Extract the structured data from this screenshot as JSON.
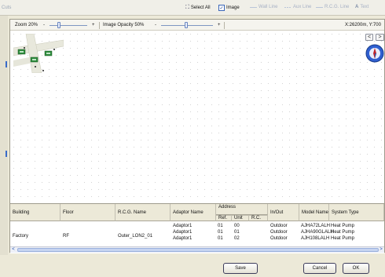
{
  "toolbar": {
    "left_label": "Cuts",
    "select_all": "Select All",
    "image": "Image",
    "wall_line": "Wall Line",
    "aux_line": "Aux Line",
    "rcg_line": "R.C.G. Line",
    "text": "Text"
  },
  "zoom": {
    "zoom_label": "Zoom 20%",
    "opacity_label": "Image Opacity 50%",
    "minus": "-",
    "plus": "+",
    "coords": "X:26200m, Y:700"
  },
  "nav": {
    "left_arrow": "<",
    "right_arrow": ">"
  },
  "table": {
    "headers": {
      "building": "Building",
      "floor": "Floor",
      "rcg_name": "R.C.G. Name",
      "adaptor_name": "Adaptor Name",
      "address": "Address",
      "ref": "Ref.",
      "unit": "Unit",
      "rc": "R.C.",
      "in_out": "In/Out",
      "model_name": "Model Name",
      "system_type": "System Type"
    },
    "group": {
      "building": "Factory",
      "floor": "RF",
      "rcg_name": "Outer_LON2_01"
    },
    "rows": [
      {
        "adaptor": "Adaptor1",
        "ref": "01",
        "unit": "00",
        "in_out": "Outdoor",
        "model": "AJHA72LALH",
        "system": "Heat Pump"
      },
      {
        "adaptor": "Adaptor1",
        "ref": "01",
        "unit": "01",
        "in_out": "Outdoor",
        "model": "AJHA90GLALH",
        "system": "Heat Pump"
      },
      {
        "adaptor": "Adaptor1",
        "ref": "01",
        "unit": "02",
        "in_out": "Outdoor",
        "model": "AJH108LALH",
        "system": "Heat Pump"
      }
    ]
  },
  "scroll": {
    "left": "<",
    "right": ">"
  },
  "footer": {
    "save": "Save",
    "cancel": "Cancel",
    "ok": "OK"
  },
  "colors": {
    "accent": "#3a66b8",
    "panel": "#ece9d8",
    "compass_blue": "#2f5fd0"
  }
}
